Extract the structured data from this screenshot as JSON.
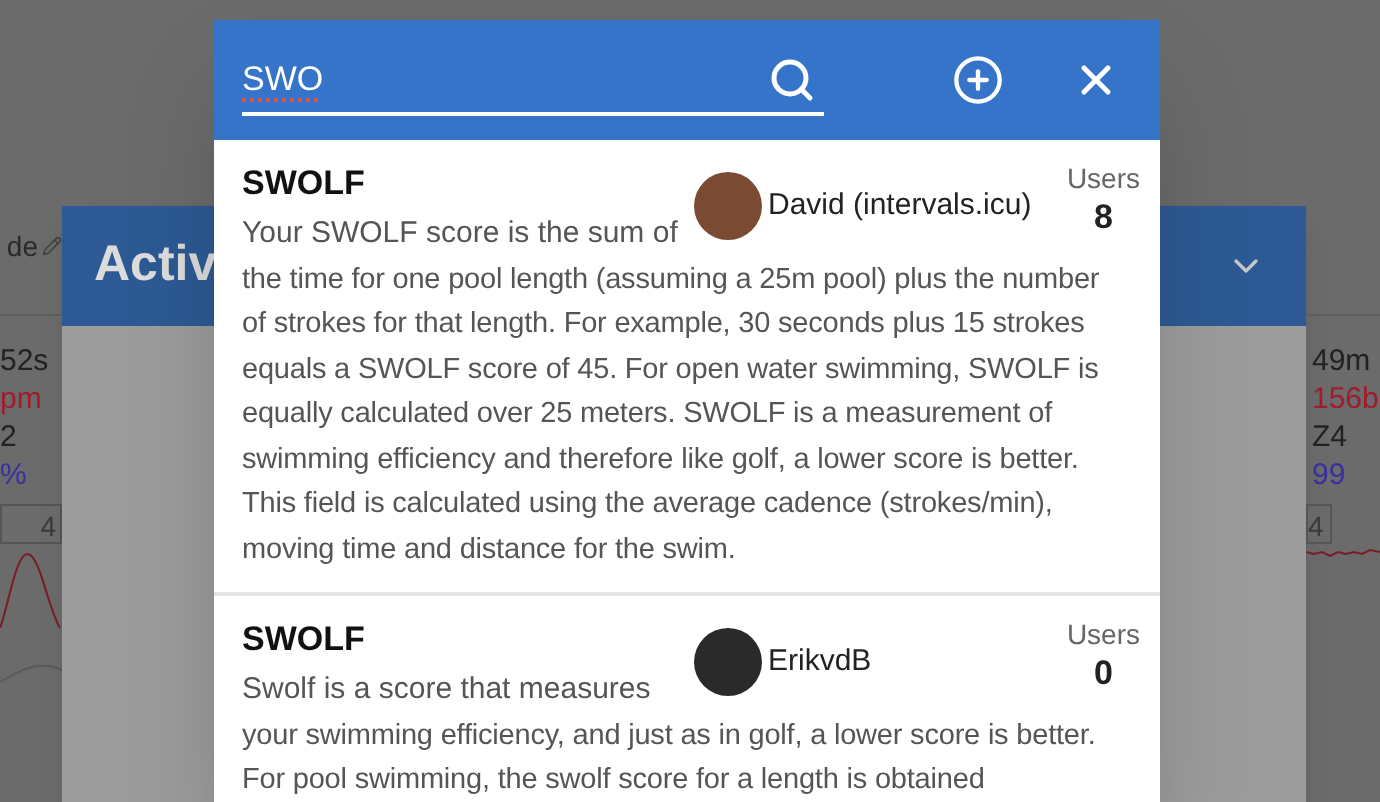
{
  "background": {
    "label": "de",
    "panel_title": "Activ",
    "left_stats": [
      {
        "text": "52s",
        "color": "#222222"
      },
      {
        "text": "pm",
        "color": "#a01c2c"
      },
      {
        "text": "2",
        "color": "#222222"
      },
      {
        "text": "%",
        "color": "#3a2fa0"
      }
    ],
    "left_tick": "4",
    "right_stats": [
      {
        "text": "49m",
        "color": "#222222"
      },
      {
        "text": "156b",
        "color": "#a01c2c"
      },
      {
        "text": "Z4",
        "color": "#222222"
      },
      {
        "text": "99",
        "color": "#3a2fa0"
      }
    ],
    "right_tick": "4"
  },
  "dialog": {
    "search": {
      "value": "SWO",
      "misspelled": true
    },
    "results": [
      {
        "title": "SWOLF",
        "author": "David (intervals.icu)",
        "users_label": "Users",
        "users_count": "8",
        "description": [
          "Your SWOLF score is the sum of",
          "the time for one pool length (assuming a 25m pool) plus the number of strokes for that length. For example, 30 seconds plus 15 strokes equals a SWOLF score of 45. For open water swimming, SWOLF is equally calculated over 25 meters. SWOLF is a measurement of swimming efficiency and therefore like golf, a lower score is better. This field is calculated using the average cadence (strokes/min), moving time and distance for the swim."
        ]
      },
      {
        "title": "SWOLF",
        "author": "ErikvdB",
        "users_label": "Users",
        "users_count": "0",
        "description": [
          "Swolf is a score that measures",
          "your swimming efficiency, and just as in golf, a lower score is better. For pool swimming, the swolf score for a length is obtained"
        ]
      }
    ]
  }
}
